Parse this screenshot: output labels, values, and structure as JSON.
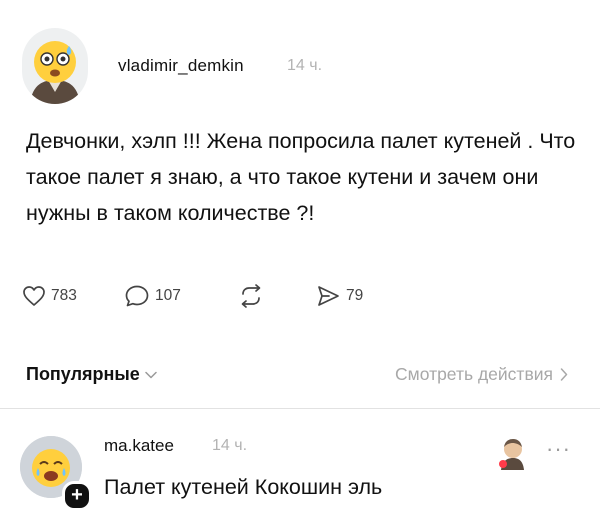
{
  "post": {
    "username": "vladimir_demkin",
    "time": "14 ч.",
    "text": "Девчонки, хэлп !!! Жена попросила палет кутеней . Что такое палет я знаю, а что такое кутени и зачем они нужны в таком количестве ?!",
    "actions": {
      "likes": "783",
      "comments": "107",
      "shares": "79"
    }
  },
  "replies_header": {
    "sort_label": "Популярные",
    "view_activity_label": "Смотреть действия"
  },
  "reply": {
    "username": "ma.katee",
    "time": "14 ч.",
    "text": "Палет кутеней Кокошин эль",
    "more_label": "···"
  },
  "icons": {
    "like": "heart-icon",
    "comment": "comment-icon",
    "repost": "repost-icon",
    "share": "send-icon",
    "plus": "plus-icon",
    "more": "more-icon"
  },
  "colors": {
    "text": "#111111",
    "muted": "#b3b3b3",
    "link_muted": "#a8a8a8",
    "divider": "#e2e2e2"
  }
}
